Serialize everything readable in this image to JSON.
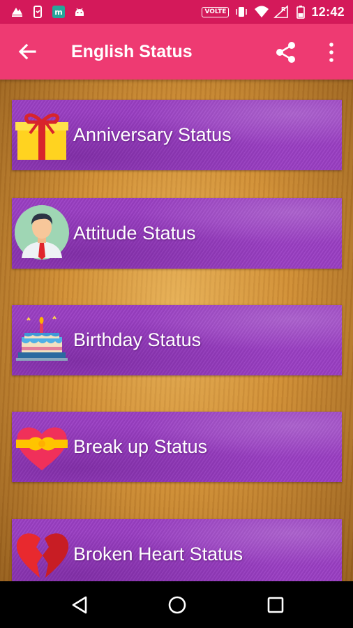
{
  "status_bar": {
    "network_badge": "VOLTE",
    "roaming_indicator": "R",
    "time": "12:42",
    "left_icons": [
      "upload-icon",
      "phone-vibrate-icon",
      "m-app-icon",
      "android-icon"
    ],
    "right_icons": [
      "vibrate-icon",
      "wifi-icon",
      "signal-icon",
      "battery-icon"
    ]
  },
  "app_bar": {
    "title": "English Status",
    "back_icon": "arrow-left-icon",
    "share_icon": "share-icon",
    "menu_icon": "more-vert-icon"
  },
  "categories": [
    {
      "label": "Anniversary Status",
      "icon": "gift-box-icon"
    },
    {
      "label": "Attitude Status",
      "icon": "man-avatar-icon"
    },
    {
      "label": "Birthday Status",
      "icon": "birthday-cake-icon"
    },
    {
      "label": "Break up Status",
      "icon": "gift-heart-icon"
    },
    {
      "label": "Broken Heart Status",
      "icon": "broken-heart-icon"
    }
  ],
  "nav_bar": {
    "back": "nav-back-icon",
    "home": "nav-home-icon",
    "recents": "nav-recents-icon"
  },
  "colors": {
    "status_bar": "#d4195a",
    "app_bar": "#ee3a72",
    "item_background": "#9b3fc4",
    "wood_background": "#c8862e"
  }
}
